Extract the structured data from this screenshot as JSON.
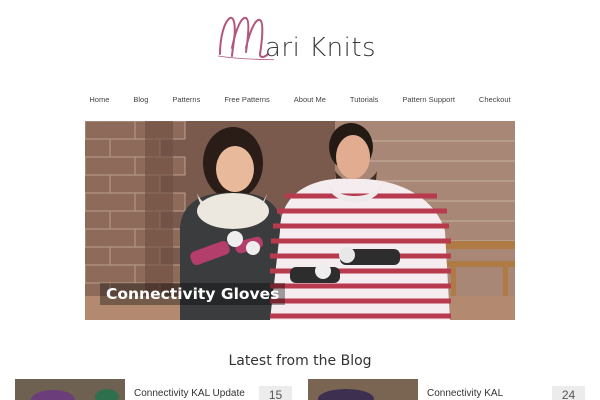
{
  "site": {
    "logo_text": "ari Knits",
    "logo_initial": "M",
    "logo_color": "#b2557f"
  },
  "nav": {
    "items": [
      "Home",
      "Blog",
      "Patterns",
      "Free Patterns",
      "About Me",
      "Tutorials",
      "Pattern Support",
      "Checkout"
    ]
  },
  "hero": {
    "caption": "Connectivity Gloves"
  },
  "blog": {
    "heading": "Latest from the Blog",
    "posts": [
      {
        "title": "Connectivity KAL Update",
        "date": "15"
      },
      {
        "title": "Connectivity KAL",
        "date": "24"
      }
    ]
  }
}
